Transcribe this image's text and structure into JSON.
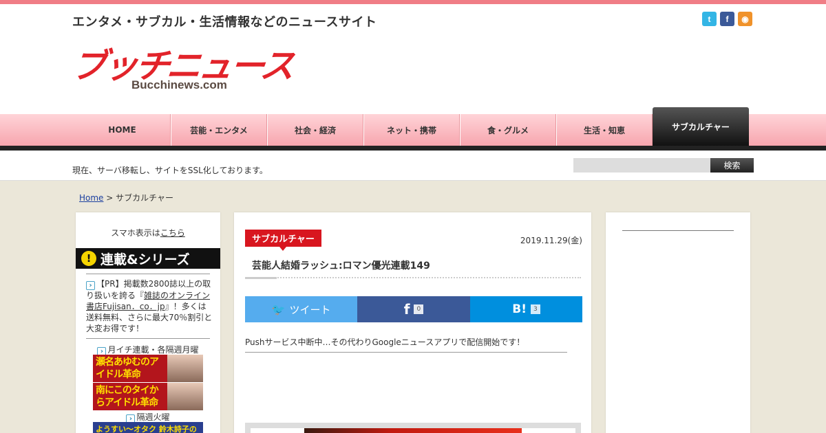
{
  "header": {
    "tagline": "エンタメ・サブカル・生活情報などのニュースサイト",
    "logo_jp": "ブッチニュース",
    "logo_en": "Bucchinews.com",
    "social": [
      {
        "icon": "twitter-icon",
        "glyph": "t"
      },
      {
        "icon": "facebook-icon",
        "glyph": "f"
      },
      {
        "icon": "rss-icon",
        "glyph": "◉"
      }
    ]
  },
  "nav": {
    "items": [
      {
        "label": "HOME"
      },
      {
        "label": "芸能・エンタメ"
      },
      {
        "label": "社会・経済"
      },
      {
        "label": "ネット・携帯"
      },
      {
        "label": "食・グルメ"
      },
      {
        "label": "生活・知恵"
      },
      {
        "label": "サブカルチャー"
      }
    ],
    "active_index": 6
  },
  "notice": "現在、サーバ移転し、サイトをSSL化しております。",
  "search": {
    "button_label": "検索",
    "placeholder": ""
  },
  "breadcrumb": {
    "home": "Home",
    "separator": " > ",
    "current": "サブカルチャー"
  },
  "sidebar_left": {
    "sp_prefix": "スマホ表示は",
    "sp_link": "こちら",
    "series_banner": "連載&シリーズ",
    "pr_prefix": "【PR】掲載数2800誌以上の取り扱いを誇る『",
    "pr_link": "雑誌のオンライン書店Fujisan．co．jp",
    "pr_suffix": "』！多くは送料無料、さらに最大70％割引と大変お得です！",
    "monthly_label": "月イチ連載・各隔週月曜",
    "banner1": "瀬名あゆむのアイドル革命",
    "banner2": "南にこのタイからアイドル革命",
    "biweekly_label": "隔週火曜",
    "banner3": "ようすい〜オタク 鈴木詩子の"
  },
  "article": {
    "category": "サブカルチャー",
    "date": "2019.11.29(金)",
    "title": "芸能人結婚ラッシュ:ロマン優光連載149",
    "share": {
      "tweet_label": "ツイート",
      "facebook_glyph": "f",
      "facebook_count": "0",
      "hatena_glyph": "B!",
      "hatena_count": "3"
    },
    "push_notice": "Pushサービス中断中…その代わりGoogleニュースアプリで配信開始です！"
  },
  "colors": {
    "accent_pink": "#f07d86",
    "category_red": "#d8161f",
    "twitter": "#55acee",
    "facebook": "#3b5998",
    "hatena": "#008fde"
  }
}
